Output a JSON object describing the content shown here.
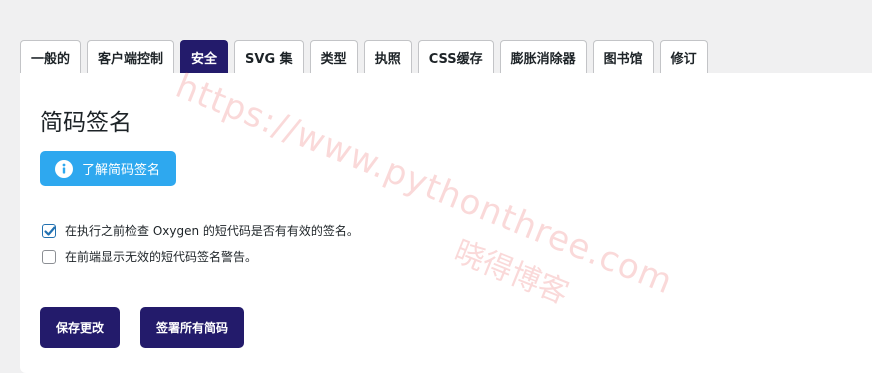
{
  "tabs": [
    {
      "label": "一般的",
      "active": false
    },
    {
      "label": "客户端控制",
      "active": false
    },
    {
      "label": "安全",
      "active": true
    },
    {
      "label": "SVG 集",
      "active": false
    },
    {
      "label": "类型",
      "active": false
    },
    {
      "label": "执照",
      "active": false
    },
    {
      "label": "CSS缓存",
      "active": false
    },
    {
      "label": "膨胀消除器",
      "active": false
    },
    {
      "label": "图书馆",
      "active": false
    },
    {
      "label": "修订",
      "active": false
    }
  ],
  "section": {
    "title": "简码签名",
    "learn_button": "了解简码签名",
    "learn_icon": "info-circle-icon"
  },
  "options": [
    {
      "label": "在执行之前检查 Oxygen 的短代码是否有有效的签名。",
      "checked": true
    },
    {
      "label": "在前端显示无效的短代码签名警告。",
      "checked": false
    }
  ],
  "actions": {
    "save_label": "保存更改",
    "sign_all_label": "签署所有简码"
  },
  "watermark": {
    "url": "https://www.pythonthree.com",
    "name": "晓得博客"
  },
  "colors": {
    "accent": "#231b6b",
    "info_button": "#2ea8ef",
    "background": "#f0f0f1",
    "checkbox_blue": "#2271b1"
  }
}
